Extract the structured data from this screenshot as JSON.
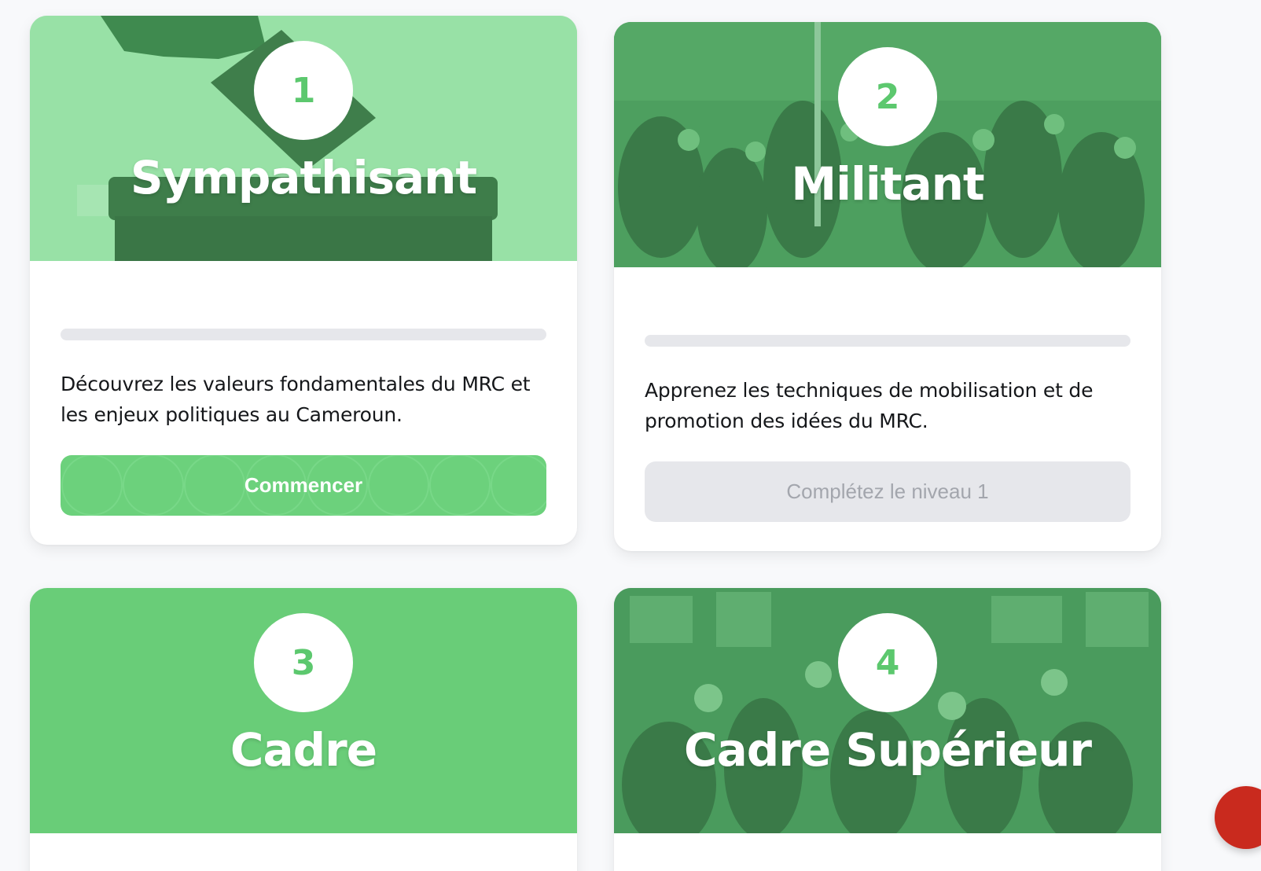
{
  "levels": [
    {
      "number": "1",
      "title": "Sympathisant",
      "description": "Découvrez les valeurs fondamentales du MRC et les enjeux politiques au Cameroun.",
      "button_label": "Commencer",
      "status": "unlocked",
      "progress": 0
    },
    {
      "number": "2",
      "title": "Militant",
      "description": "Apprenez les techniques de mobilisation et de promotion des idées du MRC.",
      "button_label": "Complétez le niveau 1",
      "status": "locked",
      "progress": 0
    },
    {
      "number": "3",
      "title": "Cadre"
    },
    {
      "number": "4",
      "title": "Cadre Supérieur"
    }
  ],
  "colors": {
    "primary_green": "#6cd17c",
    "badge_number": "#5cc86e",
    "locked_button": "#e6e7eb",
    "fab": "#c92a1e"
  },
  "icons": {
    "hero_1": "ballot-box-image",
    "hero_2": "crowd-rally-image",
    "hero_4": "meeting-group-image"
  }
}
